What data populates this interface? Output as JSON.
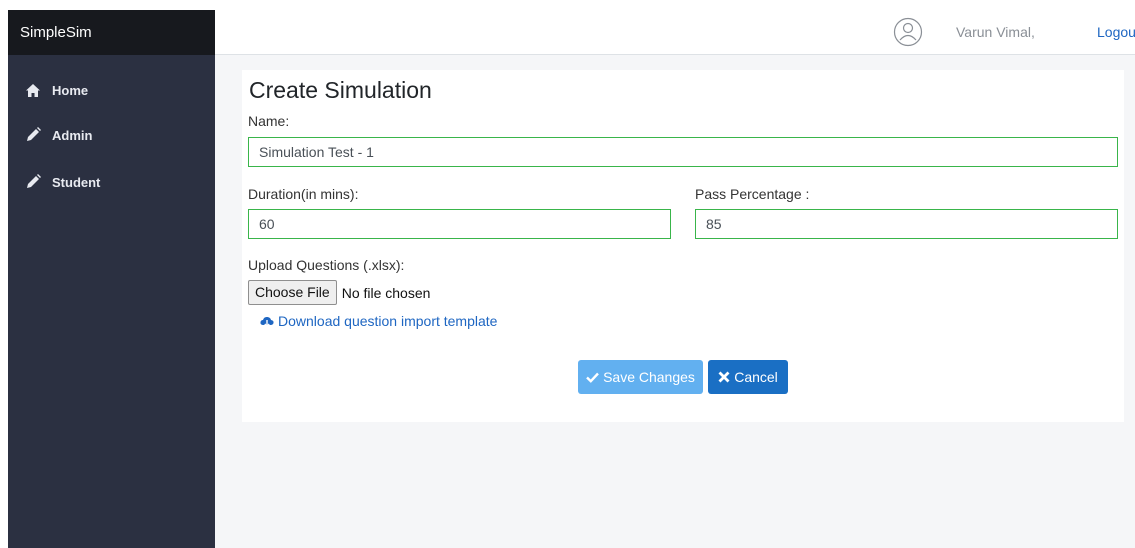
{
  "sidebar": {
    "brand": "SimpleSim",
    "items": [
      {
        "label": "Home",
        "icon": "home-icon"
      },
      {
        "label": "Admin",
        "icon": "pencil-icon"
      },
      {
        "label": "Student",
        "icon": "pencil-icon"
      }
    ]
  },
  "topbar": {
    "user_name": "Varun Vimal,",
    "logout_label": "Logout",
    "avatar_icon": "user-avatar-icon"
  },
  "form": {
    "title": "Create Simulation",
    "name_label": "Name:",
    "name_value": "Simulation Test - 1",
    "duration_label": "Duration(in mins):",
    "duration_value": "60",
    "pass_label": "Pass Percentage :",
    "pass_value": "85",
    "upload_label": "Upload Questions (.xlsx):",
    "choose_file_label": "Choose File",
    "file_status": "No file chosen",
    "download_label": "Download question import template",
    "download_icon": "cloud-download-icon",
    "save_label": "Save Changes",
    "save_icon": "check-icon",
    "cancel_label": "Cancel",
    "cancel_icon": "close-icon"
  },
  "colors": {
    "sidebar_bg": "#2b3041",
    "brand_bg": "#17191e",
    "input_border": "#39b54a",
    "link": "#1e66c2",
    "save_button": "#62b0f0",
    "cancel_button": "#1a6fc4"
  }
}
